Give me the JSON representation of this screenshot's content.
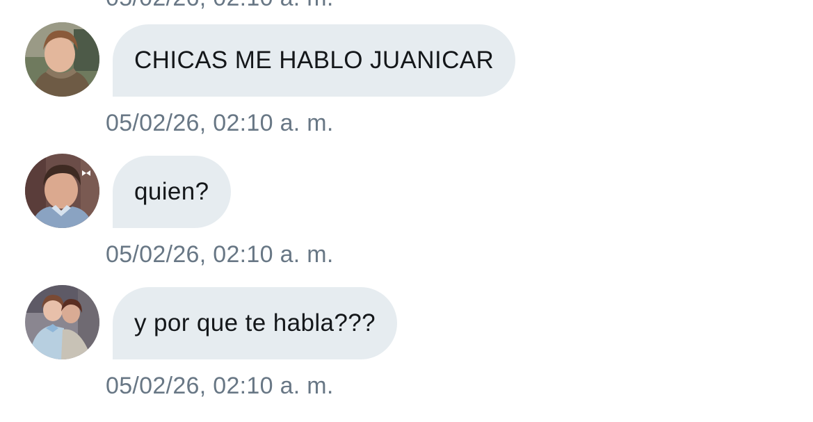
{
  "messages": [
    {
      "text": "CHICAS ME HABLO JUANICAR",
      "timestamp": "05/02/26, 02:10 a. m.",
      "avatar_icon": "user-avatar-photo"
    },
    {
      "text": "quien?",
      "timestamp": "05/02/26, 02:10 a. m.",
      "avatar_icon": "user-avatar-photo"
    },
    {
      "text": "y por que te habla???",
      "timestamp": "05/02/26, 02:10 a. m.",
      "avatar_icon": "user-avatar-photo"
    }
  ],
  "colors": {
    "bubble_bg": "#e6ecf0",
    "message_text": "#14171a",
    "timestamp_text": "#687785",
    "background": "#ffffff"
  }
}
